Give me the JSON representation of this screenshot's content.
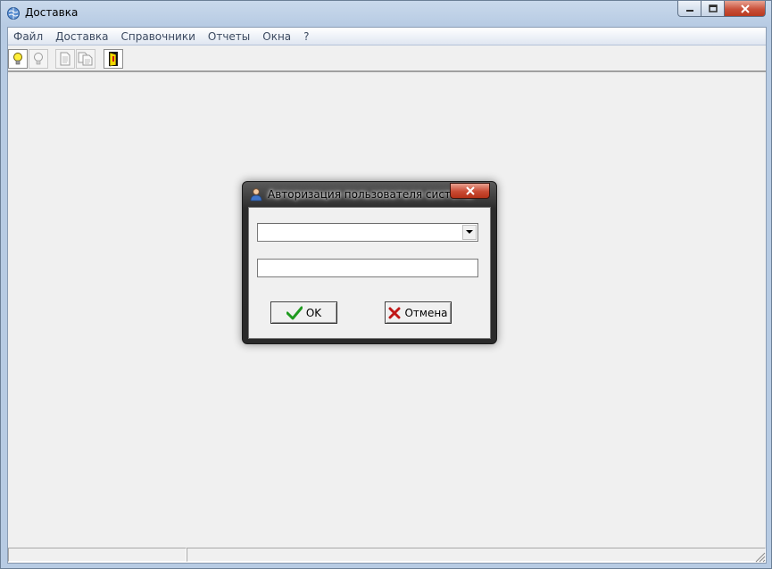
{
  "window": {
    "title": "Доставка",
    "icon": "globe-icon"
  },
  "menu": {
    "items": [
      {
        "label": "Файл"
      },
      {
        "label": "Доставка"
      },
      {
        "label": "Справочники"
      },
      {
        "label": "Отчеты"
      },
      {
        "label": "Окна"
      },
      {
        "label": "?"
      }
    ]
  },
  "toolbar": {
    "buttons": [
      {
        "icon": "lightbulb-on-icon"
      },
      {
        "icon": "lightbulb-off-icon"
      },
      {
        "icon": "document-icon"
      },
      {
        "icon": "documents-icon"
      },
      {
        "icon": "exit-door-icon"
      }
    ]
  },
  "dialog": {
    "title": "Авторизация пользователя системы",
    "icon": "user-icon",
    "user_combo_value": "",
    "password_value": "",
    "ok_label": "OK",
    "cancel_label": "Отмена"
  },
  "colors": {
    "ok_check": "#1f9a1f",
    "cancel_x": "#c01818",
    "close_red": "#c94a33"
  }
}
